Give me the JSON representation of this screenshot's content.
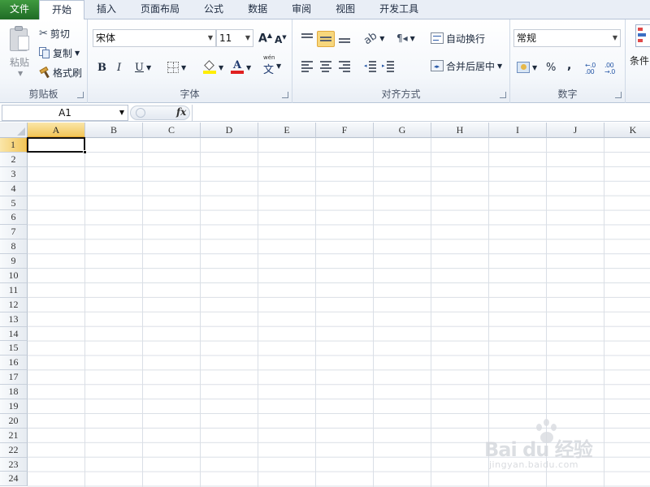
{
  "tabs": [
    {
      "label": "文件",
      "type": "file"
    },
    {
      "label": "开始",
      "active": true
    },
    {
      "label": "插入"
    },
    {
      "label": "页面布局"
    },
    {
      "label": "公式"
    },
    {
      "label": "数据"
    },
    {
      "label": "审阅"
    },
    {
      "label": "视图"
    },
    {
      "label": "开发工具"
    }
  ],
  "clipboard": {
    "paste_label": "粘贴",
    "cut_label": "剪切",
    "copy_label": "复制",
    "format_painter_label": "格式刷",
    "group_label": "剪贴板"
  },
  "font": {
    "font_name": "宋体",
    "font_size": "11",
    "bold": "B",
    "italic": "I",
    "underline": "U",
    "group_label": "字体",
    "font_color_hex": "#e02020",
    "fill_color_hex": "#ffee00"
  },
  "alignment": {
    "wrap_text_label": "自动换行",
    "merge_center_label": "合并后居中",
    "group_label": "对齐方式"
  },
  "number": {
    "format": "常规",
    "percent": "%",
    "comma": ",",
    "increase_decimal": "←.0 .00",
    "decrease_decimal": ".00 →.0",
    "group_label": "数字"
  },
  "styles": {
    "conditional_label": "条件"
  },
  "formula_bar": {
    "name_box": "A1",
    "fx": "fx",
    "value": ""
  },
  "sheet": {
    "columns": [
      "A",
      "B",
      "C",
      "D",
      "E",
      "F",
      "G",
      "H",
      "I",
      "J",
      "K"
    ],
    "rows": [
      "1",
      "2",
      "3",
      "4",
      "5",
      "6",
      "7",
      "8",
      "9",
      "10",
      "11",
      "12",
      "13",
      "14",
      "15",
      "16",
      "17",
      "18",
      "19",
      "20",
      "21",
      "22",
      "23",
      "24"
    ],
    "active_cell": "A1",
    "active_column": "A",
    "active_row": "1"
  },
  "watermark": {
    "main": "Bai du 经验",
    "sub": "jingyan.baidu.com"
  }
}
